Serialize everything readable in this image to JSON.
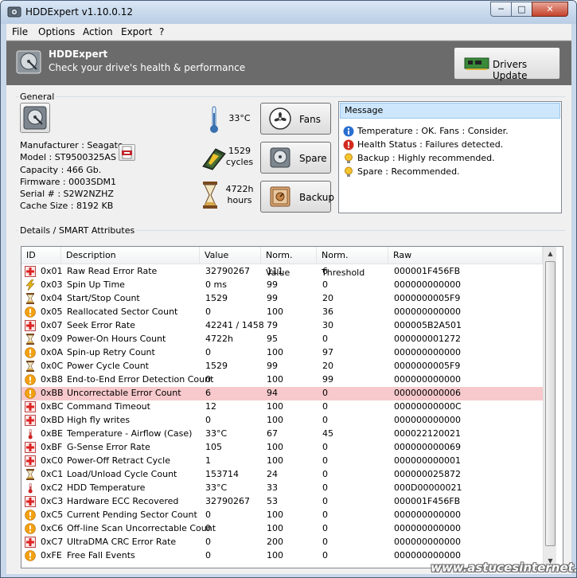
{
  "window": {
    "title": "HDDExpert v1.10.0.12",
    "min_glyph": "─",
    "max_glyph": "□",
    "close_glyph": "✕"
  },
  "menu": [
    "File",
    "Options",
    "Action",
    "Export",
    "?"
  ],
  "banner": {
    "title": "HDDExpert",
    "subtitle": "Check your drive's health & performance",
    "drivers_button": "Drivers Update"
  },
  "general": {
    "label": "General",
    "info": [
      "Manufacturer : Seagate",
      "Model : ST9500325AS",
      "Capacity : 466 Gb.",
      "Firmware : 0003SDM1",
      "Serial # : S2W2NZHZ",
      "Cache Size : 8192 KB"
    ],
    "temperature": "33°C",
    "cycles_value": "1529",
    "cycles_unit": "cycles",
    "hours_value": "4722h",
    "hours_unit": "hours",
    "buttons": {
      "fans": "Fans",
      "spare": "Spare",
      "backup": "Backup"
    }
  },
  "messages": {
    "header": "Message",
    "items": [
      {
        "icon": "info-icon",
        "text": "Temperature : OK. Fans : Consider."
      },
      {
        "icon": "error-icon",
        "text": "Health Status : Failures detected."
      },
      {
        "icon": "bulb-icon",
        "text": "Backup : Highly recommended."
      },
      {
        "icon": "bulb-icon",
        "text": "Spare : Recommended."
      }
    ]
  },
  "details": {
    "label": "Details / SMART Attributes",
    "columns": [
      "ID",
      "Description",
      "Value",
      "Norm. Value",
      "Norm. Threshold",
      "Raw"
    ],
    "selected_row": 9,
    "rows": [
      {
        "icon": "medical-cross-icon",
        "id": "0x01",
        "desc": "Raw Read Error Rate",
        "value": "32790267",
        "norm": "111",
        "thr": "6",
        "raw": "000001F456FB"
      },
      {
        "icon": "lightning-icon",
        "id": "0x03",
        "desc": "Spin Up Time",
        "value": "0 ms",
        "norm": "99",
        "thr": "0",
        "raw": "000000000000"
      },
      {
        "icon": "hourglass-icon",
        "id": "0x04",
        "desc": "Start/Stop Count",
        "value": "1529",
        "norm": "99",
        "thr": "20",
        "raw": "0000000005F9"
      },
      {
        "icon": "warning-icon",
        "id": "0x05",
        "desc": "Reallocated Sector Count",
        "value": "0",
        "norm": "100",
        "thr": "36",
        "raw": "000000000000"
      },
      {
        "icon": "medical-cross-icon",
        "id": "0x07",
        "desc": "Seek Error Rate",
        "value": "42241 / 1458",
        "norm": "79",
        "thr": "30",
        "raw": "000005B2A501"
      },
      {
        "icon": "hourglass-icon",
        "id": "0x09",
        "desc": "Power-On Hours Count",
        "value": "4722h",
        "norm": "95",
        "thr": "0",
        "raw": "000000001272"
      },
      {
        "icon": "warning-icon",
        "id": "0x0A",
        "desc": "Spin-up Retry Count",
        "value": "0",
        "norm": "100",
        "thr": "97",
        "raw": "000000000000"
      },
      {
        "icon": "hourglass-icon",
        "id": "0x0C",
        "desc": "Power Cycle Count",
        "value": "1529",
        "norm": "99",
        "thr": "20",
        "raw": "0000000005F9"
      },
      {
        "icon": "warning-icon",
        "id": "0xB8",
        "desc": "End-to-End Error Detection Count",
        "value": "0",
        "norm": "100",
        "thr": "99",
        "raw": "000000000000"
      },
      {
        "icon": "warning-icon",
        "id": "0xBB",
        "desc": "Uncorrectable Error Count",
        "value": "6",
        "norm": "94",
        "thr": "0",
        "raw": "000000000006"
      },
      {
        "icon": "medical-cross-icon",
        "id": "0xBC",
        "desc": "Command Timeout",
        "value": "12",
        "norm": "100",
        "thr": "0",
        "raw": "00000000000C"
      },
      {
        "icon": "medical-cross-icon",
        "id": "0xBD",
        "desc": "High fly writes",
        "value": "0",
        "norm": "100",
        "thr": "0",
        "raw": "000000000000"
      },
      {
        "icon": "thermometer-icon",
        "id": "0xBE",
        "desc": "Temperature - Airflow (Case)",
        "value": "33°C",
        "norm": "67",
        "thr": "45",
        "raw": "000022120021"
      },
      {
        "icon": "medical-cross-icon",
        "id": "0xBF",
        "desc": "G-Sense Error Rate",
        "value": "105",
        "norm": "100",
        "thr": "0",
        "raw": "000000000069"
      },
      {
        "icon": "medical-cross-icon",
        "id": "0xC0",
        "desc": "Power-Off Retract Cycle",
        "value": "1",
        "norm": "100",
        "thr": "0",
        "raw": "000000000001"
      },
      {
        "icon": "hourglass-icon",
        "id": "0xC1",
        "desc": "Load/Unload Cycle Count",
        "value": "153714",
        "norm": "24",
        "thr": "0",
        "raw": "000000025872"
      },
      {
        "icon": "thermometer-icon",
        "id": "0xC2",
        "desc": "HDD Temperature",
        "value": "33°C",
        "norm": "33",
        "thr": "0",
        "raw": "000D00000021"
      },
      {
        "icon": "medical-cross-icon",
        "id": "0xC3",
        "desc": "Hardware ECC Recovered",
        "value": "32790267",
        "norm": "53",
        "thr": "0",
        "raw": "000001F456FB"
      },
      {
        "icon": "warning-icon",
        "id": "0xC5",
        "desc": "Current Pending Sector Count",
        "value": "0",
        "norm": "100",
        "thr": "0",
        "raw": "000000000000"
      },
      {
        "icon": "warning-icon",
        "id": "0xC6",
        "desc": "Off-line Scan Uncorrectable Count",
        "value": "0",
        "norm": "100",
        "thr": "0",
        "raw": "000000000000"
      },
      {
        "icon": "medical-cross-icon",
        "id": "0xC7",
        "desc": "UltraDMA CRC Error Rate",
        "value": "0",
        "norm": "200",
        "thr": "0",
        "raw": "000000000000"
      },
      {
        "icon": "warning-icon",
        "id": "0xFE",
        "desc": "Free Fall Events",
        "value": "0",
        "norm": "100",
        "thr": "0",
        "raw": "000000000000"
      }
    ]
  },
  "watermark": "www.astucesinternet.com"
}
